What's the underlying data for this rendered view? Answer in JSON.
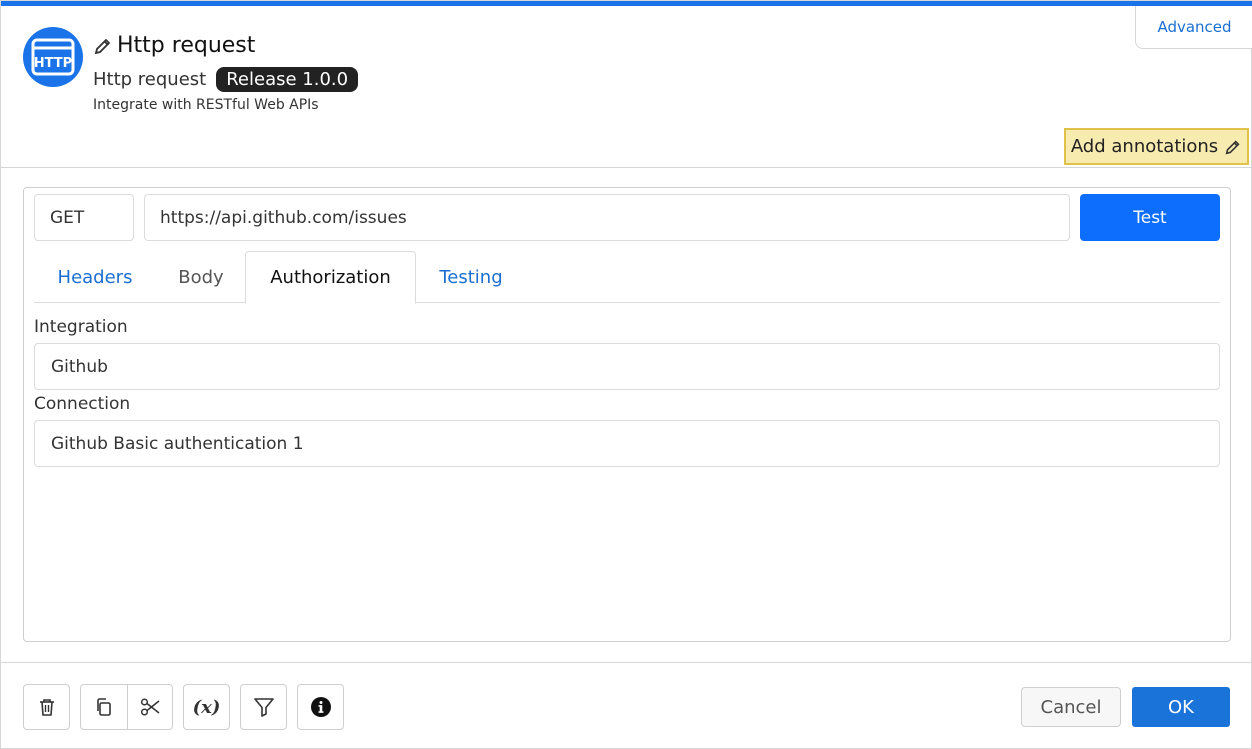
{
  "header": {
    "icon": "http-icon",
    "icon_text": "HTTP",
    "title": "Http request",
    "subtitle": "Http request",
    "version_badge": "Release 1.0.0",
    "description": "Integrate with RESTful Web APIs",
    "advanced_label": "Advanced",
    "annotations_label": "Add annotations"
  },
  "request": {
    "method": "GET",
    "url": "https://api.github.com/issues",
    "test_label": "Test"
  },
  "tabs": [
    {
      "label": "Headers",
      "state": "link"
    },
    {
      "label": "Body",
      "state": "muted"
    },
    {
      "label": "Authorization",
      "state": "active"
    },
    {
      "label": "Testing",
      "state": "link"
    }
  ],
  "authorization": {
    "integration_label": "Integration",
    "integration_value": "Github",
    "connection_label": "Connection",
    "connection_value": "Github Basic authentication 1"
  },
  "footer": {
    "tools": [
      "trash-icon",
      "copy-icon",
      "scissors-icon",
      "variable-icon",
      "filter-icon",
      "info-icon"
    ],
    "variable_label": "(x)",
    "cancel_label": "Cancel",
    "ok_label": "OK"
  },
  "colors": {
    "accent": "#1a73e8",
    "primary_button": "#0d6efd",
    "annotation_bg": "#f7ebb0",
    "annotation_border": "#e0c24a",
    "badge_bg": "#222222"
  }
}
